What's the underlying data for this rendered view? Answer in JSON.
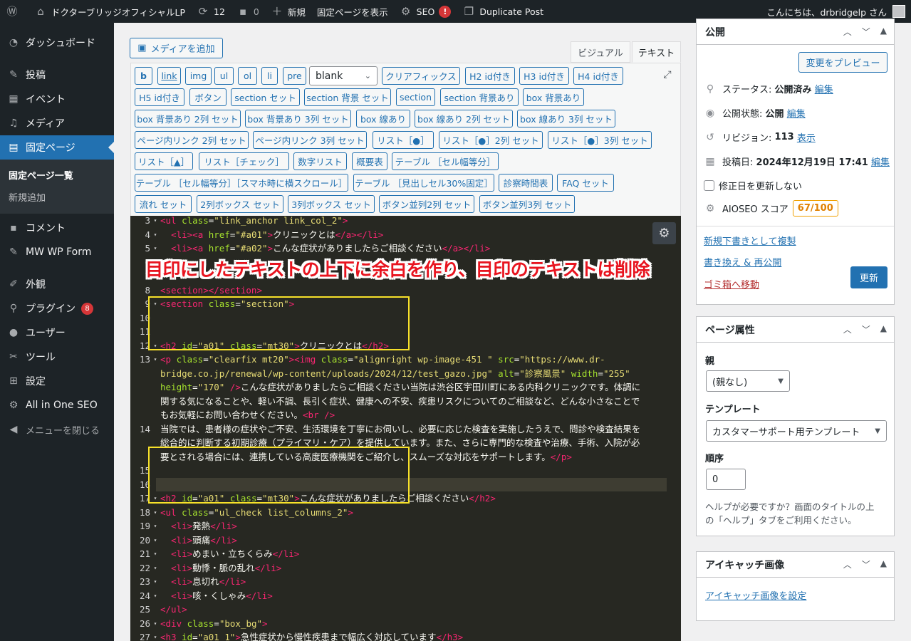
{
  "adminbar": {
    "site_name": "ドクターブリッジオフィシャルLP",
    "updates_count": "12",
    "comments_count": "0",
    "new_label": "新規",
    "view_page": "固定ページを表示",
    "seo_label": "SEO",
    "seo_alert": "!",
    "duplicate": "Duplicate Post",
    "greeting": "こんにちは、drbridgelp さん"
  },
  "sidebar": {
    "dashboard": "ダッシュボード",
    "posts": "投稿",
    "events": "イベント",
    "media": "メディア",
    "pages": "固定ページ",
    "pages_sub": [
      "固定ページ一覧",
      "新規追加"
    ],
    "comments": "コメント",
    "mwwp": "MW WP Form",
    "appearance": "外観",
    "plugins": "プラグイン",
    "plugins_badge": "8",
    "users": "ユーザー",
    "tools": "ツール",
    "settings": "設定",
    "aioseo": "All in One SEO",
    "collapse": "メニューを閉じる"
  },
  "editor": {
    "add_media": "メディアを追加",
    "tab_visual": "ビジュアル",
    "tab_text": "テキスト",
    "select_value": "blank",
    "buttons": [
      "b",
      "link",
      "img",
      "ul",
      "ol",
      "li",
      "pre",
      "クリアフィックス",
      "H2 id付き",
      "H3 id付き",
      "H4 id付き",
      "H5 id付き",
      "ボタン",
      "section セット",
      "section 背景 セット",
      "section",
      "section 背景あり",
      "box 背景あり",
      "box 背景あり 2列 セット",
      "box 背景あり 3列 セット",
      "box 線あり",
      "box 線あり 2列 セット",
      "box 線あり 3列 セット",
      "ページ内リンク 2列 セット",
      "ページ内リンク 3列 セット",
      "リスト［●］",
      "リスト［●］2列 セット",
      "リスト［●］3列 セット",
      "リスト［▲］",
      "リスト［チェック］",
      "数字リスト",
      "概要表",
      "テーブル ［セル幅等分］",
      "テーブル ［セル幅等分］［スマホ時に横スクロール］",
      "テーブル ［見出しセル30%固定］",
      "診察時間表",
      "FAQ セット",
      "流れ セット",
      "2列ボックス セット",
      "3列ボックス セット",
      "ボタン並列2列 セット",
      "ボタン並列3列 セット"
    ],
    "annotation": "目印にしたテキストの上下に余白を作り、目印のテキストは削除",
    "code_lines": [
      {
        "n": "3",
        "f": "▾",
        "t": [
          [
            "tg",
            "<ul "
          ],
          [
            "at",
            "class"
          ],
          [
            "tx",
            "="
          ],
          [
            "st",
            "\"link_anchor link_col_2\""
          ],
          [
            "tg",
            ">"
          ]
        ]
      },
      {
        "n": "4",
        "f": "▾",
        "t": [
          [
            "tx",
            "  "
          ],
          [
            "tg",
            "<li><a "
          ],
          [
            "at",
            "href"
          ],
          [
            "tx",
            "="
          ],
          [
            "st",
            "\"#a01\""
          ],
          [
            "tg",
            ">"
          ],
          [
            "tx",
            "クリニックとは"
          ],
          [
            "tg",
            "</a></li>"
          ]
        ]
      },
      {
        "n": "5",
        "f": "▾",
        "t": [
          [
            "tx",
            "  "
          ],
          [
            "tg",
            "<li><a "
          ],
          [
            "at",
            "href"
          ],
          [
            "tx",
            "="
          ],
          [
            "st",
            "\"#a02\""
          ],
          [
            "tg",
            ">"
          ],
          [
            "tx",
            "こんな症状がありましたらご相談ください"
          ],
          [
            "tg",
            "</a></li>"
          ]
        ]
      },
      {
        "n": "6",
        "f": "",
        "t": []
      },
      {
        "n": "7",
        "f": "",
        "t": []
      },
      {
        "n": "8",
        "f": "",
        "t": [
          [
            "tg",
            "<section></section>"
          ]
        ]
      },
      {
        "n": "9",
        "f": "▾",
        "t": [
          [
            "tg",
            "<section "
          ],
          [
            "at",
            "class"
          ],
          [
            "tx",
            "="
          ],
          [
            "st",
            "\"section\""
          ],
          [
            "tg",
            ">"
          ]
        ]
      },
      {
        "n": "10",
        "f": "",
        "t": []
      },
      {
        "n": "11",
        "f": "",
        "t": []
      },
      {
        "n": "12",
        "f": "▾",
        "t": [
          [
            "tg",
            "<h2 "
          ],
          [
            "at",
            "id"
          ],
          [
            "tx",
            "="
          ],
          [
            "st",
            "\"a01\" "
          ],
          [
            "at",
            "class"
          ],
          [
            "tx",
            "="
          ],
          [
            "st",
            "\"mt30\""
          ],
          [
            "tg",
            ">"
          ],
          [
            "tx",
            "クリニックとは"
          ],
          [
            "tg",
            "</h2>"
          ]
        ]
      },
      {
        "n": "13",
        "f": "▾",
        "t": [
          [
            "tg",
            "<p "
          ],
          [
            "at",
            "class"
          ],
          [
            "tx",
            "="
          ],
          [
            "st",
            "\"clearfix mt20\""
          ],
          [
            "tg",
            "><img "
          ],
          [
            "at",
            "class"
          ],
          [
            "tx",
            "="
          ],
          [
            "st",
            "\"alignright wp-image-451 \" "
          ],
          [
            "at",
            "src"
          ],
          [
            "tx",
            "="
          ],
          [
            "st",
            "\"https://www.dr-"
          ]
        ]
      },
      {
        "n": "",
        "f": "",
        "t": [
          [
            "st",
            "bridge.co.jp/renewal/wp-content/uploads/2024/12/test_gazo.jpg\" "
          ],
          [
            "at",
            "alt"
          ],
          [
            "tx",
            "="
          ],
          [
            "st",
            "\"診察風景\" "
          ],
          [
            "at",
            "width"
          ],
          [
            "tx",
            "="
          ],
          [
            "st",
            "\"255\""
          ]
        ]
      },
      {
        "n": "",
        "f": "",
        "t": [
          [
            "at",
            "height"
          ],
          [
            "tx",
            "="
          ],
          [
            "st",
            "\"170\" "
          ],
          [
            "tg",
            "/>"
          ],
          [
            "tx",
            "こんな症状がありましたらご相談ください当院は渋谷区宇田川町にある内科クリニックです。体調に"
          ]
        ]
      },
      {
        "n": "",
        "f": "",
        "t": [
          [
            "tx",
            "関する気になることや、軽い不調、長引く症状、健康への不安、疾患リスクについてのご相談など、どんな小さなことで"
          ]
        ]
      },
      {
        "n": "",
        "f": "",
        "t": [
          [
            "tx",
            "もお気軽にお問い合わせください。"
          ],
          [
            "tg",
            "<br />"
          ]
        ]
      },
      {
        "n": "14",
        "f": "",
        "t": [
          [
            "tx",
            "当院では、患者様の症状やご不安、生活環境を丁寧にお伺いし、必要に応じた検査を実施したうえで、問診や検査結果を"
          ]
        ]
      },
      {
        "n": "",
        "f": "",
        "t": [
          [
            "tx",
            "総合的に判断する初期診療（プライマリ・ケア）を提供しています。また、さらに専門的な検査や治療、手術、入院が必"
          ]
        ]
      },
      {
        "n": "",
        "f": "",
        "t": [
          [
            "tx",
            "要とされる場合には、連携している高度医療機関をご紹介し、スムーズな対応をサポートします。"
          ],
          [
            "tg",
            "</p>"
          ]
        ]
      },
      {
        "n": "15",
        "f": "",
        "t": []
      },
      {
        "n": "16",
        "f": "",
        "t": []
      },
      {
        "n": "17",
        "f": "▾",
        "t": [
          [
            "tg",
            "<h2 "
          ],
          [
            "at",
            "id"
          ],
          [
            "tx",
            "="
          ],
          [
            "st",
            "\"a01\" "
          ],
          [
            "at",
            "class"
          ],
          [
            "tx",
            "="
          ],
          [
            "st",
            "\"mt30\""
          ],
          [
            "tg",
            ">"
          ],
          [
            "tx",
            "こんな症状がありましたらご相談ください"
          ],
          [
            "tg",
            "</h2>"
          ]
        ]
      },
      {
        "n": "18",
        "f": "▾",
        "t": [
          [
            "tg",
            "<ul "
          ],
          [
            "at",
            "class"
          ],
          [
            "tx",
            "="
          ],
          [
            "st",
            "\"ul_check list_columns_2\""
          ],
          [
            "tg",
            ">"
          ]
        ]
      },
      {
        "n": "19",
        "f": "▾",
        "t": [
          [
            "tx",
            "  "
          ],
          [
            "tg",
            "<li>"
          ],
          [
            "tx",
            "発熱"
          ],
          [
            "tg",
            "</li>"
          ]
        ]
      },
      {
        "n": "20",
        "f": "▾",
        "t": [
          [
            "tx",
            "  "
          ],
          [
            "tg",
            "<li>"
          ],
          [
            "tx",
            "頭痛"
          ],
          [
            "tg",
            "</li>"
          ]
        ]
      },
      {
        "n": "21",
        "f": "▾",
        "t": [
          [
            "tx",
            "  "
          ],
          [
            "tg",
            "<li>"
          ],
          [
            "tx",
            "めまい・立ちくらみ"
          ],
          [
            "tg",
            "</li>"
          ]
        ]
      },
      {
        "n": "22",
        "f": "▾",
        "t": [
          [
            "tx",
            "  "
          ],
          [
            "tg",
            "<li>"
          ],
          [
            "tx",
            "動悸・脈の乱れ"
          ],
          [
            "tg",
            "</li>"
          ]
        ]
      },
      {
        "n": "23",
        "f": "▾",
        "t": [
          [
            "tx",
            "  "
          ],
          [
            "tg",
            "<li>"
          ],
          [
            "tx",
            "息切れ"
          ],
          [
            "tg",
            "</li>"
          ]
        ]
      },
      {
        "n": "24",
        "f": "▾",
        "t": [
          [
            "tx",
            "  "
          ],
          [
            "tg",
            "<li>"
          ],
          [
            "tx",
            "咳・くしゃみ"
          ],
          [
            "tg",
            "</li>"
          ]
        ]
      },
      {
        "n": "25",
        "f": "",
        "t": [
          [
            "tg",
            "</ul>"
          ]
        ]
      },
      {
        "n": "26",
        "f": "▾",
        "t": [
          [
            "tg",
            "<div "
          ],
          [
            "at",
            "class"
          ],
          [
            "tx",
            "="
          ],
          [
            "st",
            "\"box_bg\""
          ],
          [
            "tg",
            ">"
          ]
        ]
      },
      {
        "n": "27",
        "f": "▾",
        "t": [
          [
            "tg",
            "<h3 "
          ],
          [
            "at",
            "id"
          ],
          [
            "tx",
            "="
          ],
          [
            "st",
            "\"a01_1\""
          ],
          [
            "tg",
            ">"
          ],
          [
            "tx",
            "急性症状から慢性疾患まで幅広く対応しています"
          ],
          [
            "tg",
            "</h3>"
          ]
        ]
      }
    ]
  },
  "publish": {
    "title": "公開",
    "preview": "変更をプレビュー",
    "status_label": "ステータス:",
    "status_value": "公開済み",
    "edit": "編集",
    "visibility_label": "公開状態:",
    "visibility_value": "公開",
    "revision_label": "リビジョン:",
    "revision_value": "113",
    "revision_link": "表示",
    "date_label": "投稿日:",
    "date_value": "2024年12月19日 17:41",
    "no_update_date": "修正日を更新しない",
    "aioseo_label": "AIOSEO スコア",
    "aioseo_score": "67/100",
    "copy_draft": "新規下書きとして複製",
    "rewrite": "書き換え & 再公開",
    "trash": "ゴミ箱へ移動",
    "update": "更新"
  },
  "attributes": {
    "title": "ページ属性",
    "parent_label": "親",
    "parent_value": "(親なし)",
    "template_label": "テンプレート",
    "template_value": "カスタマーサポート用テンプレート",
    "order_label": "順序",
    "order_value": "0",
    "help": [
      "ヘルプが必要ですか？画面のタイトルの上",
      "の「ヘルプ」タブをご利用ください。"
    ]
  },
  "featured": {
    "title": "アイキャッチ画像",
    "set_link": "アイキャッチ画像を設定"
  }
}
